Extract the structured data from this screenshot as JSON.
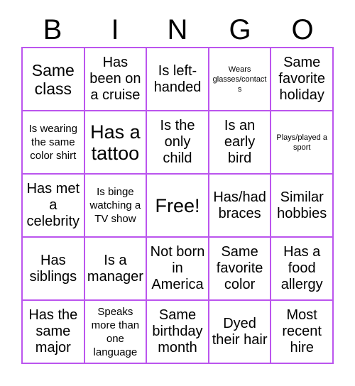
{
  "card": {
    "title": "BINGO",
    "border_color": "#bb55ee",
    "text_color": "#000000",
    "background_color": "#ffffff"
  },
  "header": {
    "letters": [
      "B",
      "I",
      "N",
      "G",
      "O"
    ]
  },
  "grid": {
    "rows": 5,
    "columns": 5,
    "cells": [
      {
        "text": "Same class",
        "size": "lg"
      },
      {
        "text": "Has been on a cruise",
        "size": "md"
      },
      {
        "text": "Is left-handed",
        "size": "md"
      },
      {
        "text": "Wears glasses/contacts",
        "size": "xs"
      },
      {
        "text": "Same favorite holiday",
        "size": "md"
      },
      {
        "text": "Is wearing the same color shirt",
        "size": "sm"
      },
      {
        "text": "Has a tattoo",
        "size": "xl"
      },
      {
        "text": "Is the only child",
        "size": "md"
      },
      {
        "text": "Is an early bird",
        "size": "md"
      },
      {
        "text": "Plays/played a sport",
        "size": "xs"
      },
      {
        "text": "Has met a celebrity",
        "size": "md"
      },
      {
        "text": "Is binge watching a TV show",
        "size": "sm"
      },
      {
        "text": "Free!",
        "size": "xl"
      },
      {
        "text": "Has/had braces",
        "size": "md"
      },
      {
        "text": "Similar hobbies",
        "size": "md"
      },
      {
        "text": "Has siblings",
        "size": "md"
      },
      {
        "text": "Is a manager",
        "size": "md"
      },
      {
        "text": "Not born in America",
        "size": "md"
      },
      {
        "text": "Same favorite color",
        "size": "md"
      },
      {
        "text": "Has a food allergy",
        "size": "md"
      },
      {
        "text": "Has the same major",
        "size": "md"
      },
      {
        "text": "Speaks more than one language",
        "size": "sm"
      },
      {
        "text": "Same birthday month",
        "size": "md"
      },
      {
        "text": "Dyed their hair",
        "size": "md"
      },
      {
        "text": "Most recent hire",
        "size": "md"
      }
    ]
  }
}
